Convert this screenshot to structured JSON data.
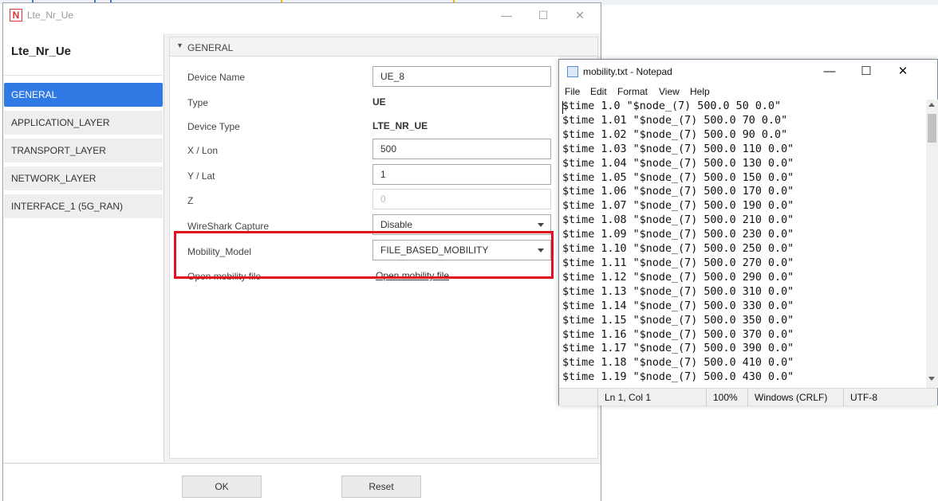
{
  "dialog": {
    "title": "Lte_Nr_Ue",
    "app_icon_letter": "N",
    "heading": "Lte_Nr_Ue",
    "window_buttons": {
      "minimize": "—",
      "maximize": "☐",
      "close": "✕"
    }
  },
  "sidebar": {
    "items": [
      {
        "label": "GENERAL",
        "active": true
      },
      {
        "label": "APPLICATION_LAYER",
        "active": false
      },
      {
        "label": "TRANSPORT_LAYER",
        "active": false
      },
      {
        "label": "NETWORK_LAYER",
        "active": false
      },
      {
        "label": "INTERFACE_1 (5G_RAN)",
        "active": false
      }
    ]
  },
  "panel": {
    "title": "GENERAL",
    "fields": {
      "device_name": {
        "label": "Device Name",
        "value": "UE_8"
      },
      "type": {
        "label": "Type",
        "value": "UE"
      },
      "device_type": {
        "label": "Device Type",
        "value": "LTE_NR_UE"
      },
      "x_lon": {
        "label": "X / Lon",
        "value": "500"
      },
      "y_lat": {
        "label": "Y / Lat",
        "value": "1"
      },
      "z": {
        "label": "Z",
        "value": "0"
      },
      "wireshark": {
        "label": "WireShark Capture",
        "value": "Disable"
      },
      "mobility_model": {
        "label": "Mobility_Model",
        "value": "FILE_BASED_MOBILITY"
      },
      "open_mobility": {
        "label": "Open mobility file",
        "link": "Open mobility file"
      }
    }
  },
  "footer": {
    "ok": "OK",
    "reset": "Reset"
  },
  "notepad": {
    "title": "mobility.txt - Notepad",
    "window_buttons": {
      "minimize": "—",
      "maximize": "☐",
      "close": "✕"
    },
    "menu": [
      "File",
      "Edit",
      "Format",
      "View",
      "Help"
    ],
    "lines": [
      "$time 1.0 \"$node_(7) 500.0 50 0.0\"",
      "$time 1.01 \"$node_(7) 500.0 70 0.0\"",
      "$time 1.02 \"$node_(7) 500.0 90 0.0\"",
      "$time 1.03 \"$node_(7) 500.0 110 0.0\"",
      "$time 1.04 \"$node_(7) 500.0 130 0.0\"",
      "$time 1.05 \"$node_(7) 500.0 150 0.0\"",
      "$time 1.06 \"$node_(7) 500.0 170 0.0\"",
      "$time 1.07 \"$node_(7) 500.0 190 0.0\"",
      "$time 1.08 \"$node_(7) 500.0 210 0.0\"",
      "$time 1.09 \"$node_(7) 500.0 230 0.0\"",
      "$time 1.10 \"$node_(7) 500.0 250 0.0\"",
      "$time 1.11 \"$node_(7) 500.0 270 0.0\"",
      "$time 1.12 \"$node_(7) 500.0 290 0.0\"",
      "$time 1.13 \"$node_(7) 500.0 310 0.0\"",
      "$time 1.14 \"$node_(7) 500.0 330 0.0\"",
      "$time 1.15 \"$node_(7) 500.0 350 0.0\"",
      "$time 1.16 \"$node_(7) 500.0 370 0.0\"",
      "$time 1.17 \"$node_(7) 500.0 390 0.0\"",
      "$time 1.18 \"$node_(7) 500.0 410 0.0\"",
      "$time 1.19 \"$node_(7) 500.0 430 0.0\""
    ],
    "status": {
      "position": "Ln 1, Col 1",
      "zoom": "100%",
      "line_endings": "Windows (CRLF)",
      "encoding": "UTF-8"
    }
  },
  "colors": {
    "accent": "#2f7ae5",
    "highlight": "#e0101e"
  }
}
